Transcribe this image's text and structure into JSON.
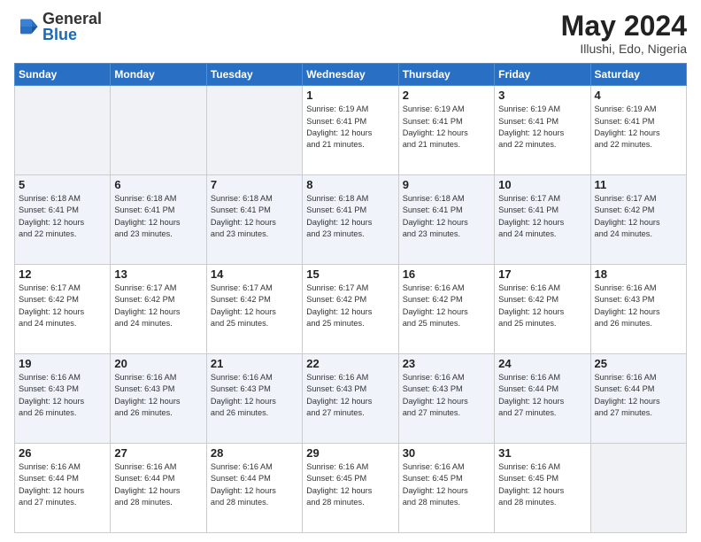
{
  "header": {
    "logo_general": "General",
    "logo_blue": "Blue",
    "month_year": "May 2024",
    "location": "Illushi, Edo, Nigeria"
  },
  "days_of_week": [
    "Sunday",
    "Monday",
    "Tuesday",
    "Wednesday",
    "Thursday",
    "Friday",
    "Saturday"
  ],
  "weeks": [
    [
      {
        "day": "",
        "info": ""
      },
      {
        "day": "",
        "info": ""
      },
      {
        "day": "",
        "info": ""
      },
      {
        "day": "1",
        "info": "Sunrise: 6:19 AM\nSunset: 6:41 PM\nDaylight: 12 hours\nand 21 minutes."
      },
      {
        "day": "2",
        "info": "Sunrise: 6:19 AM\nSunset: 6:41 PM\nDaylight: 12 hours\nand 21 minutes."
      },
      {
        "day": "3",
        "info": "Sunrise: 6:19 AM\nSunset: 6:41 PM\nDaylight: 12 hours\nand 22 minutes."
      },
      {
        "day": "4",
        "info": "Sunrise: 6:19 AM\nSunset: 6:41 PM\nDaylight: 12 hours\nand 22 minutes."
      }
    ],
    [
      {
        "day": "5",
        "info": "Sunrise: 6:18 AM\nSunset: 6:41 PM\nDaylight: 12 hours\nand 22 minutes."
      },
      {
        "day": "6",
        "info": "Sunrise: 6:18 AM\nSunset: 6:41 PM\nDaylight: 12 hours\nand 23 minutes."
      },
      {
        "day": "7",
        "info": "Sunrise: 6:18 AM\nSunset: 6:41 PM\nDaylight: 12 hours\nand 23 minutes."
      },
      {
        "day": "8",
        "info": "Sunrise: 6:18 AM\nSunset: 6:41 PM\nDaylight: 12 hours\nand 23 minutes."
      },
      {
        "day": "9",
        "info": "Sunrise: 6:18 AM\nSunset: 6:41 PM\nDaylight: 12 hours\nand 23 minutes."
      },
      {
        "day": "10",
        "info": "Sunrise: 6:17 AM\nSunset: 6:41 PM\nDaylight: 12 hours\nand 24 minutes."
      },
      {
        "day": "11",
        "info": "Sunrise: 6:17 AM\nSunset: 6:42 PM\nDaylight: 12 hours\nand 24 minutes."
      }
    ],
    [
      {
        "day": "12",
        "info": "Sunrise: 6:17 AM\nSunset: 6:42 PM\nDaylight: 12 hours\nand 24 minutes."
      },
      {
        "day": "13",
        "info": "Sunrise: 6:17 AM\nSunset: 6:42 PM\nDaylight: 12 hours\nand 24 minutes."
      },
      {
        "day": "14",
        "info": "Sunrise: 6:17 AM\nSunset: 6:42 PM\nDaylight: 12 hours\nand 25 minutes."
      },
      {
        "day": "15",
        "info": "Sunrise: 6:17 AM\nSunset: 6:42 PM\nDaylight: 12 hours\nand 25 minutes."
      },
      {
        "day": "16",
        "info": "Sunrise: 6:16 AM\nSunset: 6:42 PM\nDaylight: 12 hours\nand 25 minutes."
      },
      {
        "day": "17",
        "info": "Sunrise: 6:16 AM\nSunset: 6:42 PM\nDaylight: 12 hours\nand 25 minutes."
      },
      {
        "day": "18",
        "info": "Sunrise: 6:16 AM\nSunset: 6:43 PM\nDaylight: 12 hours\nand 26 minutes."
      }
    ],
    [
      {
        "day": "19",
        "info": "Sunrise: 6:16 AM\nSunset: 6:43 PM\nDaylight: 12 hours\nand 26 minutes."
      },
      {
        "day": "20",
        "info": "Sunrise: 6:16 AM\nSunset: 6:43 PM\nDaylight: 12 hours\nand 26 minutes."
      },
      {
        "day": "21",
        "info": "Sunrise: 6:16 AM\nSunset: 6:43 PM\nDaylight: 12 hours\nand 26 minutes."
      },
      {
        "day": "22",
        "info": "Sunrise: 6:16 AM\nSunset: 6:43 PM\nDaylight: 12 hours\nand 27 minutes."
      },
      {
        "day": "23",
        "info": "Sunrise: 6:16 AM\nSunset: 6:43 PM\nDaylight: 12 hours\nand 27 minutes."
      },
      {
        "day": "24",
        "info": "Sunrise: 6:16 AM\nSunset: 6:44 PM\nDaylight: 12 hours\nand 27 minutes."
      },
      {
        "day": "25",
        "info": "Sunrise: 6:16 AM\nSunset: 6:44 PM\nDaylight: 12 hours\nand 27 minutes."
      }
    ],
    [
      {
        "day": "26",
        "info": "Sunrise: 6:16 AM\nSunset: 6:44 PM\nDaylight: 12 hours\nand 27 minutes."
      },
      {
        "day": "27",
        "info": "Sunrise: 6:16 AM\nSunset: 6:44 PM\nDaylight: 12 hours\nand 28 minutes."
      },
      {
        "day": "28",
        "info": "Sunrise: 6:16 AM\nSunset: 6:44 PM\nDaylight: 12 hours\nand 28 minutes."
      },
      {
        "day": "29",
        "info": "Sunrise: 6:16 AM\nSunset: 6:45 PM\nDaylight: 12 hours\nand 28 minutes."
      },
      {
        "day": "30",
        "info": "Sunrise: 6:16 AM\nSunset: 6:45 PM\nDaylight: 12 hours\nand 28 minutes."
      },
      {
        "day": "31",
        "info": "Sunrise: 6:16 AM\nSunset: 6:45 PM\nDaylight: 12 hours\nand 28 minutes."
      },
      {
        "day": "",
        "info": ""
      }
    ]
  ]
}
